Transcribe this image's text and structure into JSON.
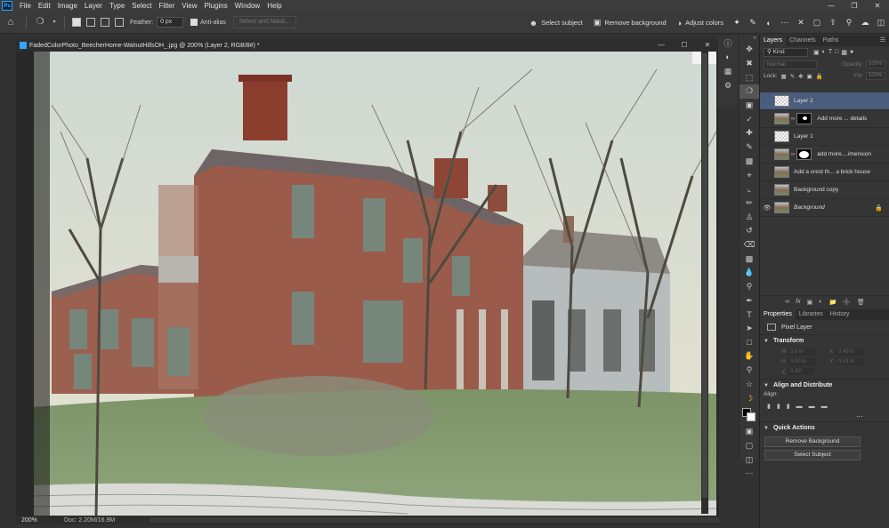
{
  "app": {
    "logo": "Ps",
    "menu": [
      "File",
      "Edit",
      "Image",
      "Layer",
      "Type",
      "Select",
      "Filter",
      "View",
      "Plugins",
      "Window",
      "Help"
    ]
  },
  "options": {
    "feather_label": "Feather:",
    "feather_value": "0 px",
    "antialias_label": "Anti-alias",
    "select_mask_label": "Select and Mask...",
    "select_subject_label": "Select subject",
    "remove_background_label": "Remove background",
    "adjust_colors_label": "Adjust colors"
  },
  "document": {
    "tab_title": "FadedColorPhoto_BeecherHome-WalnutHillsOH_.jpg @ 200% (Layer 2, RGB/8#) *",
    "zoom": "200%",
    "doc_info": "Doc: 2.20M/16.9M"
  },
  "layers_panel": {
    "tabs": [
      "Layers",
      "Channels",
      "Paths"
    ],
    "filter_kind": "Kind",
    "blend_mode": "Normal",
    "opacity_label": "Opacity:",
    "opacity_value": "100%",
    "lock_label": "Lock:",
    "fill_label": "Fill:",
    "fill_value": "100%",
    "layers": [
      {
        "name": "Layer 2",
        "visible": false,
        "selected": true,
        "thumb": "blank"
      },
      {
        "name": "Add more ... details",
        "visible": false,
        "selected": false,
        "thumb": "photo",
        "mask": "small"
      },
      {
        "name": "Layer 1",
        "visible": false,
        "selected": false,
        "thumb": "blank"
      },
      {
        "name": "add more....imension",
        "visible": false,
        "selected": false,
        "thumb": "photo",
        "mask": "large"
      },
      {
        "name": "Add a crest th... a brick house",
        "visible": false,
        "selected": false,
        "thumb": "photo"
      },
      {
        "name": "Background copy",
        "visible": false,
        "selected": false,
        "thumb": "photo"
      },
      {
        "name": "Background",
        "visible": true,
        "selected": false,
        "thumb": "photo",
        "locked": true
      }
    ]
  },
  "properties_panel": {
    "tabs": [
      "Properties",
      "Libraries",
      "History"
    ],
    "pixel_layer_label": "Pixel Layer",
    "transform_label": "Transform",
    "transform": {
      "w": "0.0 in",
      "x": "0.49 in",
      "h": "0.00 in",
      "y": "0.03 in",
      "angle": "0.00°"
    },
    "align_label": "Align and Distribute",
    "align_sub": "Align:",
    "quick_actions_label": "Quick Actions",
    "remove_background_btn": "Remove Background",
    "select_subject_btn": "Select Subject"
  },
  "colors": {
    "accent": "#31a8ff",
    "selected_layer": "#4a5d7c"
  }
}
